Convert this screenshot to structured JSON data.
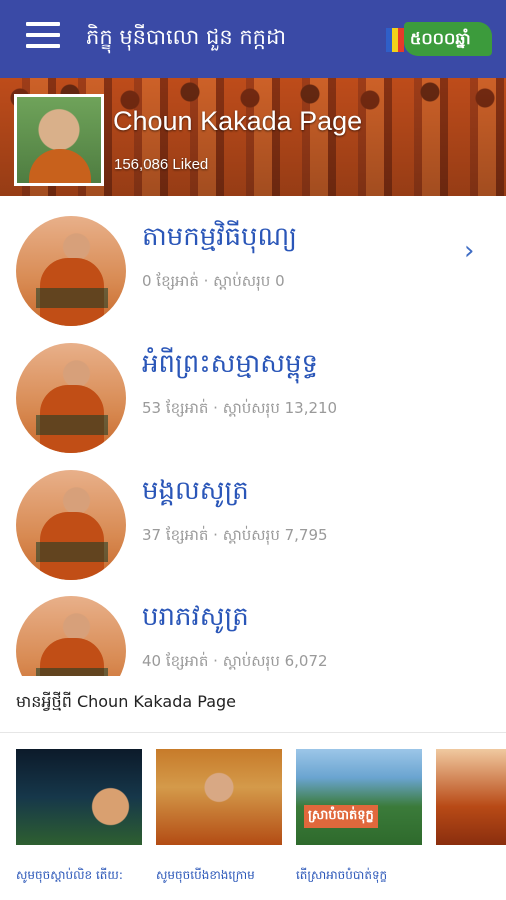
{
  "appbar": {
    "title": "ភិក្ខុ មុនីបាលោ ជួន កក្កដា",
    "badge_text": "៥០០០ឆ្នាំ",
    "colors": {
      "bar": "#3a4aa6",
      "badge_green": "#3c9b3c"
    }
  },
  "cover": {
    "page_name": "Choun Kakada Page",
    "likes": "156,086 Liked"
  },
  "items": [
    {
      "title": "តាមកម្មវិធីបុណ្យ",
      "meta": "0 ខ្សែអាត់ · ស្តាប់សរុប 0",
      "has_chevron": true
    },
    {
      "title": "អំពីព្រះសម្មាសម្ពុទ្ធ",
      "meta": "53 ខ្សែអាត់ · ស្តាប់សរុប 13,210"
    },
    {
      "title": "មង្គលសូត្រ",
      "meta": "37 ខ្សែអាត់ · ស្តាប់សរុប 7,795"
    },
    {
      "title": "បរាភវសូត្រ",
      "meta": "40 ខ្សែអាត់ · ស្តាប់សរុប 6,072"
    }
  ],
  "chevron_icon": "›",
  "whats_new": "មានអ្វីថ្មីពី Choun Kakada Page",
  "videos": [
    {
      "caption": "សូមចុចស្តាប់លិខ តើយ:"
    },
    {
      "caption": "សូមចុចបើងខាងក្រោម"
    },
    {
      "caption": "តើស្រាអាចបំបាត់ទុក្ខ",
      "thumb_text": "ស្រាបំបាត់ទុក្ខ"
    },
    {
      "caption": ""
    }
  ]
}
